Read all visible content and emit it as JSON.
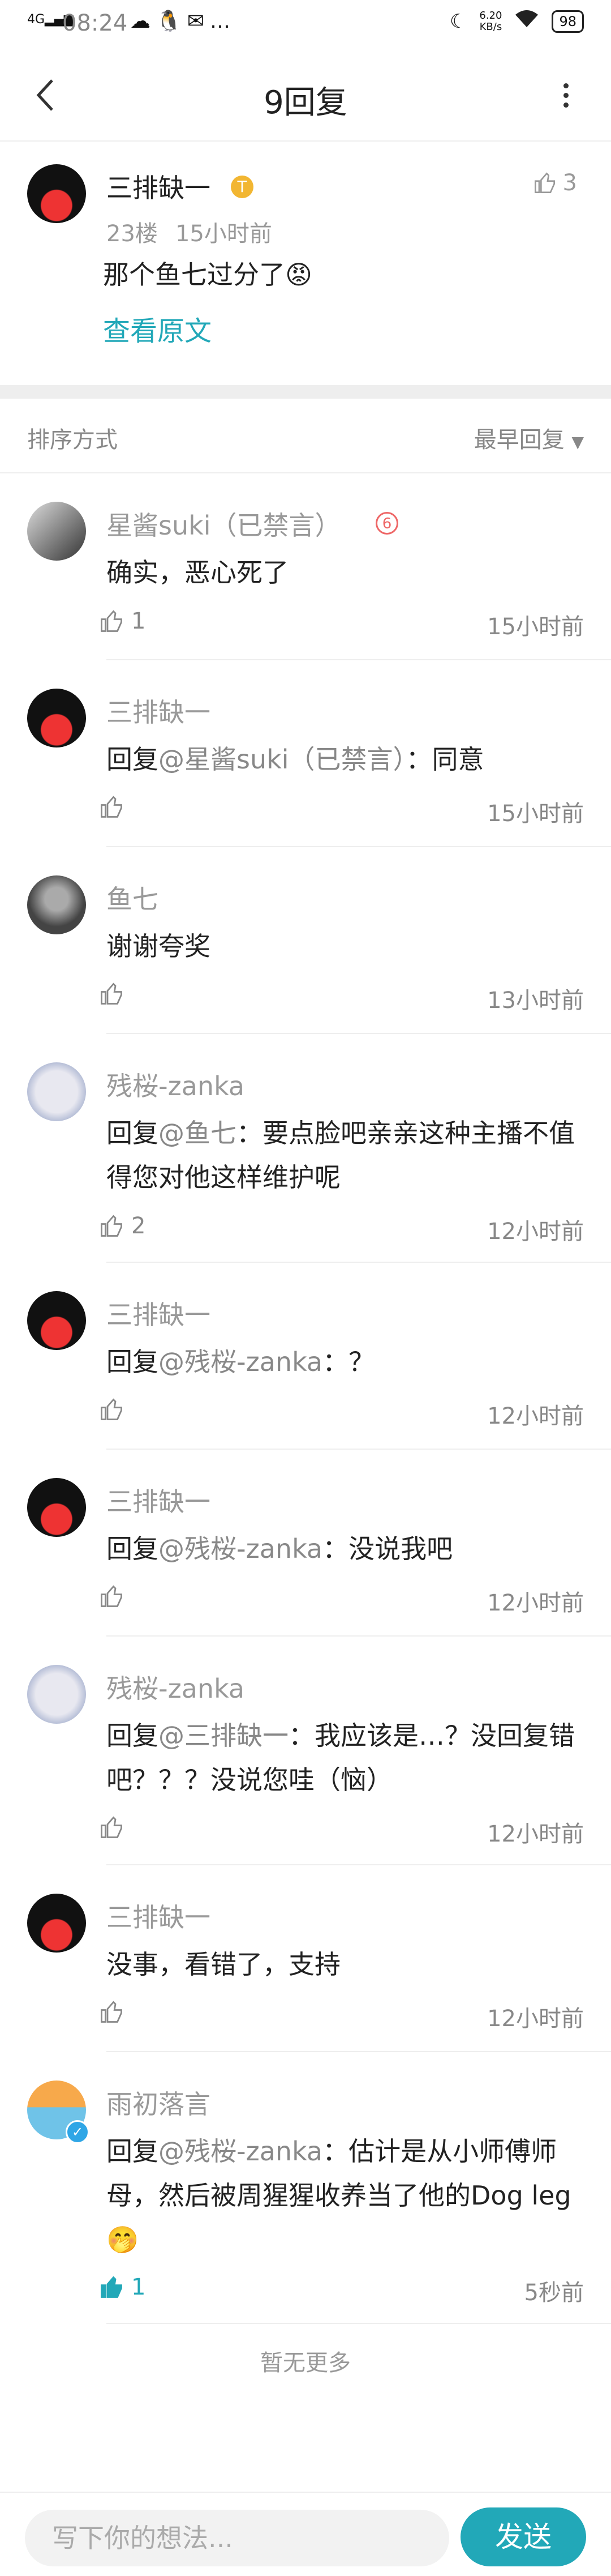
{
  "status_bar": {
    "time": "08:24",
    "signal_label": "4G",
    "notif_icons": [
      "☁",
      "🐧",
      "✉",
      "…"
    ],
    "net_speed_value": "6.20",
    "net_speed_unit": "KB/s",
    "battery": "98"
  },
  "header": {
    "title": "9回复"
  },
  "top_post": {
    "author": "三排缺一",
    "badge": "T",
    "likes": "3",
    "floor": "23楼",
    "time": "15小时前",
    "content": "那个鱼七过分了😡",
    "view_original": "查看原文"
  },
  "sort": {
    "label": "排序方式",
    "value": "最早回复"
  },
  "replies": [
    {
      "author": "星酱suki（已禁言）",
      "prefix": "",
      "mention": "",
      "content": "确实，恶心死了",
      "likes": "1",
      "time": "15小时前"
    },
    {
      "author": "三排缺一",
      "prefix": "回复",
      "mention": "@星酱suki（已禁言）",
      "content": "：同意",
      "likes": "",
      "time": "15小时前"
    },
    {
      "author": "鱼七",
      "prefix": "",
      "mention": "",
      "content": "谢谢夸奖",
      "likes": "",
      "time": "13小时前"
    },
    {
      "author": "残桜-zanka",
      "prefix": "回复",
      "mention": "@鱼七",
      "content": "：要点脸吧亲亲这种主播不值得您对他这样维护呢",
      "likes": "2",
      "time": "12小时前"
    },
    {
      "author": "三排缺一",
      "prefix": "回复",
      "mention": "@残桜-zanka",
      "content": "：？",
      "likes": "",
      "time": "12小时前"
    },
    {
      "author": "三排缺一",
      "prefix": "回复",
      "mention": "@残桜-zanka",
      "content": "：没说我吧",
      "likes": "",
      "time": "12小时前"
    },
    {
      "author": "残桜-zanka",
      "prefix": "回复",
      "mention": "@三排缺一",
      "content": "：我应该是…？没回复错吧？？？没说您哇（恼）",
      "likes": "",
      "time": "12小时前"
    },
    {
      "author": "三排缺一",
      "prefix": "",
      "mention": "",
      "content": "没事，看错了，支持",
      "likes": "",
      "time": "12小时前"
    },
    {
      "author": "雨初落言",
      "prefix": "回复",
      "mention": "@残桜-zanka",
      "content": "：估计是从小师傅师母，然后被周猩猩收养当了他的Dog leg🤭",
      "likes": "1",
      "time": "5秒前"
    }
  ],
  "no_more": "暂无更多",
  "footer": {
    "placeholder": "写下你的想法...",
    "send": "发送"
  },
  "colors": {
    "accent": "#22a8b8",
    "muted": "#999999"
  }
}
